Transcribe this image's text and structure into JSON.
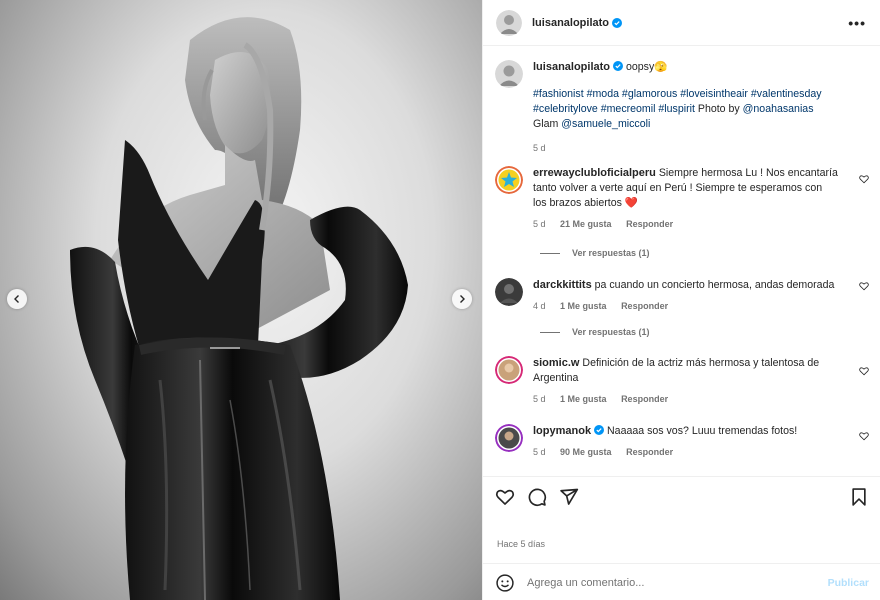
{
  "post": {
    "author": "luisanalopilato",
    "caption_text": "oopsy",
    "caption_emoji": "🫣",
    "hashtags_line1": "#fashionist #moda #glamorous #loveisintheair #valentinesday",
    "hashtags_line2": "#celebritylove #mecreomil #luspirit",
    "photo_by_label": "Photo by",
    "photo_by_handle": "@noahasanias",
    "glam_label": "Glam",
    "glam_handle": "@samuele_miccoli",
    "caption_time": "5 d",
    "posted_ago": "Hace 5 días"
  },
  "comments": [
    {
      "user": "errewayclubloficialperu",
      "text_line1": "Siempre hermosa Lu ! Nos encantaría",
      "text_line2": "tanto volver a verte aquí en Perú ! Siempre te esperamos con",
      "text_line3": "los brazos abiertos",
      "emoji": "❤️",
      "time": "5 d",
      "likes": "21 Me gusta",
      "reply": "Responder",
      "view_replies": "Ver respuestas (1)"
    },
    {
      "user": "darckkittits",
      "text_line1": "pa cuando un concierto hermosa, andas demorada",
      "time": "4 d",
      "likes": "1 Me gusta",
      "reply": "Responder",
      "view_replies": "Ver respuestas (1)"
    },
    {
      "user": "siomic.w",
      "text_line1": "Definición de la actriz más hermosa y talentosa de",
      "text_line2": "Argentina",
      "time": "5 d",
      "likes": "1 Me gusta",
      "reply": "Responder"
    },
    {
      "user": "lopymanok",
      "text_line1": "Naaaaa sos vos? Luuu tremendas fotos!",
      "time": "5 d",
      "likes": "90 Me gusta",
      "reply": "Responder"
    }
  ],
  "composer": {
    "placeholder": "Agrega un comentario...",
    "publish_label": "Publicar"
  },
  "colors": {
    "link": "#00376b",
    "verified": "#0095f6",
    "publish_disabled": "#b2dffc",
    "muted": "#737373"
  }
}
